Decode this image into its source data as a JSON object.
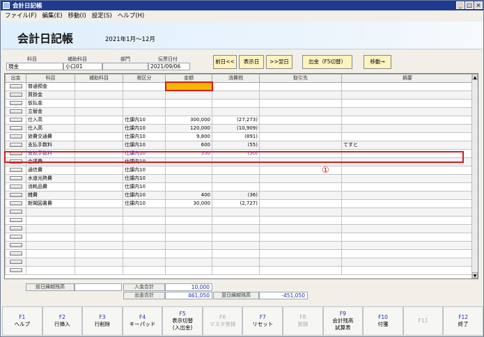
{
  "window": {
    "title": "会計日記帳"
  },
  "menu": [
    "ファイル(F)",
    "編集(E)",
    "移動(I)",
    "設定(S)",
    "ヘルプ(H)"
  ],
  "header": {
    "title": "会計日記帳",
    "period": "2021年1月～12月"
  },
  "filters": {
    "labels": {
      "account": "科目",
      "subaccount": "補助科目",
      "department": "部門",
      "date": "伝票日付"
    },
    "account": "現金",
    "subaccount": "小口01",
    "department": "",
    "date": "2021/09/06"
  },
  "nav": {
    "prev": "前日<<",
    "show": "表示日",
    "next": ">>翌日",
    "io": "出金（F5切替）",
    "move": "移動→"
  },
  "columns": [
    "出金",
    "科目",
    "補助科目",
    "税区分",
    "金額",
    "消費税",
    "取引先",
    "摘要"
  ],
  "rows": [
    [
      "",
      "普通預金",
      "",
      "",
      "",
      "",
      "",
      ""
    ],
    [
      "",
      "買掛金",
      "",
      "",
      "",
      "",
      "",
      ""
    ],
    [
      "",
      "仮払金",
      "",
      "",
      "",
      "",
      "",
      ""
    ],
    [
      "",
      "立替金",
      "",
      "",
      "",
      "",
      "",
      ""
    ],
    [
      "",
      "仕入高",
      "",
      "仕課内10",
      "300,000",
      "(27,273)",
      "",
      ""
    ],
    [
      "",
      "仕入高",
      "",
      "仕課内10",
      "120,000",
      "(10,909)",
      "",
      ""
    ],
    [
      "",
      "旅費交通費",
      "",
      "仕課内10",
      "9,800",
      "(891)",
      "",
      ""
    ],
    [
      "",
      "支払手数料",
      "",
      "仕課内10",
      "600",
      "(55)",
      "",
      "てすと"
    ],
    [
      "",
      "支払手数料",
      "",
      "仕課内10",
      "550",
      "(50)",
      "",
      ""
    ],
    [
      "",
      "会議費",
      "",
      "仕課内10",
      "",
      "",
      "",
      ""
    ],
    [
      "",
      "通信費",
      "",
      "仕課内10",
      "",
      "",
      "",
      ""
    ],
    [
      "",
      "水道光熱費",
      "",
      "仕課内10",
      "",
      "",
      "",
      ""
    ],
    [
      "",
      "消耗品費",
      "",
      "仕課内10",
      "",
      "",
      "",
      ""
    ],
    [
      "",
      "雑費",
      "",
      "仕課内10",
      "400",
      "(36)",
      "",
      ""
    ],
    [
      "",
      "新聞図書費",
      "",
      "仕課内10",
      "30,000",
      "(2,727)",
      "",
      ""
    ],
    [
      "",
      "",
      "",
      "",
      "",
      "",
      "",
      ""
    ],
    [
      "",
      "",
      "",
      "",
      "",
      "",
      "",
      ""
    ],
    [
      "",
      "",
      "",
      "",
      "",
      "",
      "",
      ""
    ],
    [
      "",
      "",
      "",
      "",
      "",
      "",
      "",
      ""
    ],
    [
      "",
      "",
      "",
      "",
      "",
      "",
      "",
      ""
    ],
    [
      "",
      "",
      "",
      "",
      "",
      "",
      "",
      ""
    ],
    [
      "",
      "",
      "",
      "",
      "",
      "",
      "",
      ""
    ],
    [
      "",
      "",
      "",
      "",
      "",
      "",
      "",
      ""
    ]
  ],
  "annotation": "①",
  "totals": {
    "prev_label": "前日繰越残高",
    "prev_value": "",
    "in_label": "入金合計",
    "in_value": "10,000",
    "out_label": "出金合計",
    "out_value": "461,050",
    "next_label": "翌日繰越残高",
    "next_value": "-451,050"
  },
  "fkeys": [
    {
      "key": "F1",
      "label": "ヘルプ",
      "enabled": true
    },
    {
      "key": "F2",
      "label": "行挿入",
      "enabled": true
    },
    {
      "key": "F3",
      "label": "行削除",
      "enabled": true
    },
    {
      "key": "F4",
      "label": "キーパッド",
      "enabled": true
    },
    {
      "key": "F5",
      "label": "表示切替\n(入出金)",
      "enabled": true
    },
    {
      "key": "F6",
      "label": "マスタ登録",
      "enabled": false
    },
    {
      "key": "F7",
      "label": "リセット",
      "enabled": true
    },
    {
      "key": "F8",
      "label": "登録",
      "enabled": false
    },
    {
      "key": "F9",
      "label": "会計残高\n試算表",
      "enabled": true
    },
    {
      "key": "F10",
      "label": "付箋",
      "enabled": true
    },
    {
      "key": "F11",
      "label": "",
      "enabled": false
    },
    {
      "key": "F12",
      "label": "終了",
      "enabled": true
    }
  ],
  "colors": {
    "titlebar": "#1f3b8f",
    "highlight": "#d7191c",
    "selected_cell": "#f5b800",
    "blue_text": "#1a2fb5"
  }
}
